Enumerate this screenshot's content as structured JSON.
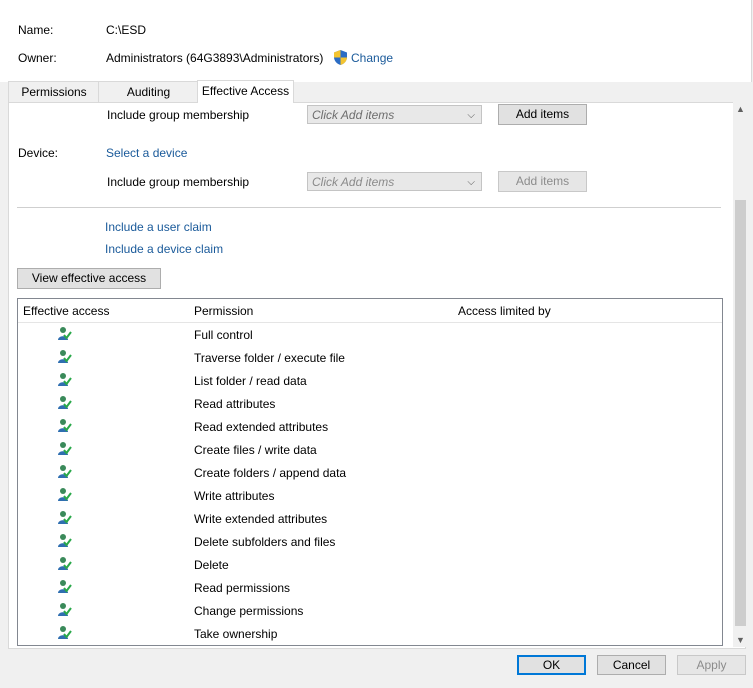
{
  "header": {
    "name_label": "Name:",
    "name_value": "C:\\ESD",
    "owner_label": "Owner:",
    "owner_value": "Administrators (64G3893\\Administrators)",
    "change_link": "Change"
  },
  "tabs": [
    {
      "label": "Permissions"
    },
    {
      "label": "Auditing"
    },
    {
      "label": "Effective Access",
      "active": true
    }
  ],
  "user_section": {
    "include_group_label": "Include group membership",
    "combo_placeholder": "Click Add items",
    "add_items_label": "Add items"
  },
  "device_section": {
    "device_label": "Device:",
    "select_device_link": "Select a device",
    "include_group_label": "Include group membership",
    "combo_placeholder": "Click Add items",
    "add_items_label": "Add items"
  },
  "claims": {
    "user_claim_link": "Include a user claim",
    "device_claim_link": "Include a device claim"
  },
  "view_button": "View effective access",
  "grid": {
    "columns": [
      "Effective access",
      "Permission",
      "Access limited by"
    ],
    "rows": [
      {
        "permission": "Full control"
      },
      {
        "permission": "Traverse folder / execute file"
      },
      {
        "permission": "List folder / read data"
      },
      {
        "permission": "Read attributes"
      },
      {
        "permission": "Read extended attributes"
      },
      {
        "permission": "Create files / write data"
      },
      {
        "permission": "Create folders / append data"
      },
      {
        "permission": "Write attributes"
      },
      {
        "permission": "Write extended attributes"
      },
      {
        "permission": "Delete subfolders and files"
      },
      {
        "permission": "Delete"
      },
      {
        "permission": "Read permissions"
      },
      {
        "permission": "Change permissions"
      },
      {
        "permission": "Take ownership"
      }
    ]
  },
  "footer": {
    "ok_label": "OK",
    "cancel_label": "Cancel",
    "apply_label": "Apply"
  },
  "colors": {
    "link": "#1a5a9a",
    "accent": "#0078d7"
  },
  "icons": {
    "shield": "uac-shield-icon",
    "row_icon": "effective-access-user-icon",
    "combo_arrow": "chevron-down-icon"
  }
}
